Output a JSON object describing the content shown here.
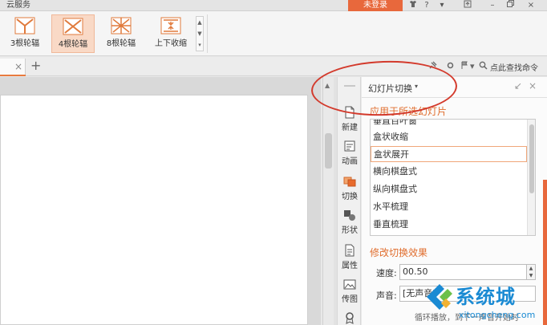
{
  "topbar": {
    "cloud_label": "云服务",
    "login_label": "未登录",
    "icons": [
      "shirt-icon",
      "help-icon",
      "upload-icon",
      "minimize-icon",
      "restore-icon",
      "close-icon"
    ],
    "help_label": "?"
  },
  "ribbon": {
    "gallery": [
      {
        "label": "3根轮辐",
        "icon": "wheel-icon",
        "selected": false
      },
      {
        "label": "4根轮辐",
        "icon": "wheel-icon",
        "selected": true
      },
      {
        "label": "8根轮辐",
        "icon": "wheel-icon",
        "selected": false
      },
      {
        "label": "上下收缩",
        "icon": "shrink-vertical-icon",
        "selected": false
      }
    ]
  },
  "tabs": {
    "close_label": "×",
    "add_label": "+",
    "find_command": "点此查找命令"
  },
  "sidebar": {
    "items": [
      {
        "label": "新建",
        "icon": "new-slide-icon"
      },
      {
        "label": "动画",
        "icon": "animation-icon"
      },
      {
        "label": "切换",
        "icon": "transition-icon"
      },
      {
        "label": "形状",
        "icon": "shape-icon"
      },
      {
        "label": "属性",
        "icon": "properties-icon"
      },
      {
        "label": "传图",
        "icon": "upload-image-icon"
      }
    ]
  },
  "pane": {
    "title": "幻灯片切换",
    "apply_section": "应用于所选幻灯片",
    "transitions": [
      "垂直百叶窗",
      "盒状收缩",
      "盒状展开",
      "横向棋盘式",
      "纵向棋盘式",
      "水平梳理",
      "垂直梳理"
    ],
    "selected_transition": "盒状展开",
    "modify_section": "修改切换效果",
    "speed_label": "速度:",
    "speed_value": "00.50",
    "sound_label": "声音:",
    "sound_value": "[无声音]",
    "loop_text": "循环播放，到下一声音开始时"
  },
  "watermark": {
    "name": "系统城",
    "url": "xitongcheng.com"
  },
  "colors": {
    "accent": "#e8683c",
    "section_title": "#e06d2d",
    "annotation": "#d33a2c",
    "watermark": "#1a8ad3"
  }
}
